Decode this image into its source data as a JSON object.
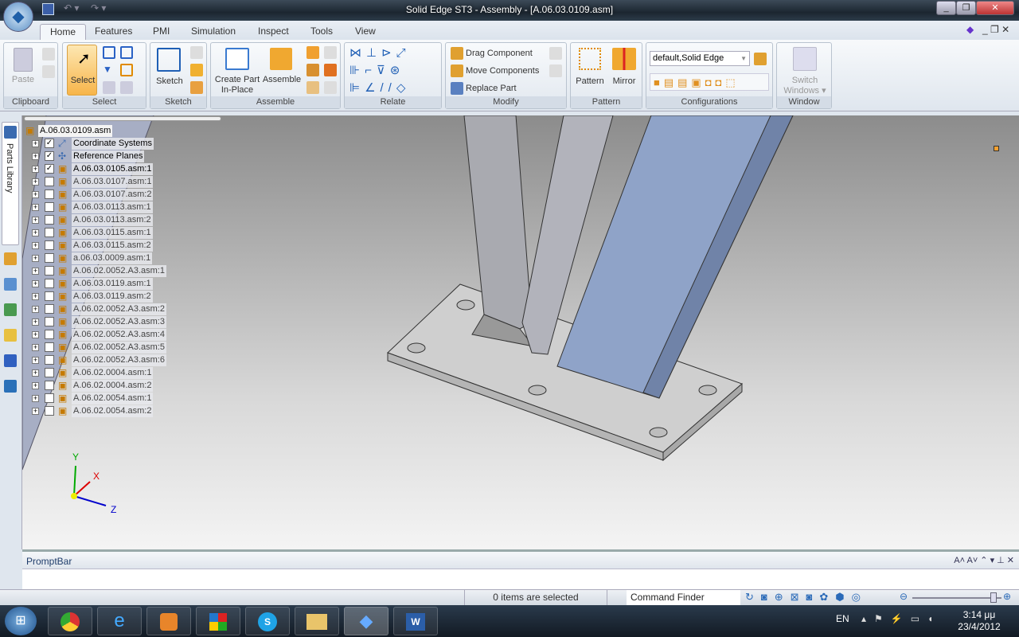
{
  "window": {
    "title": "Solid Edge ST3 - Assembly - [A.06.03.0109.asm]"
  },
  "tabs": [
    "Home",
    "Features",
    "PMI",
    "Simulation",
    "Inspect",
    "Tools",
    "View"
  ],
  "ribbon": {
    "clipboard": {
      "label": "Clipboard",
      "paste": "Paste"
    },
    "select": {
      "label": "Select",
      "select": "Select"
    },
    "sketch": {
      "label": "Sketch",
      "sketch": "Sketch"
    },
    "assemble": {
      "label": "Assemble",
      "create_part_1": "Create Part",
      "create_part_2": "In-Place",
      "assemble": "Assemble"
    },
    "relate": {
      "label": "Relate"
    },
    "modify": {
      "label": "Modify",
      "drag": "Drag Component",
      "move": "Move Components",
      "replace": "Replace Part"
    },
    "pattern": {
      "label": "Pattern",
      "pattern": "Pattern",
      "mirror": "Mirror"
    },
    "configurations": {
      "label": "Configurations",
      "value": "default,Solid Edge"
    },
    "window": {
      "label": "Window",
      "switch_1": "Switch",
      "switch_2": "Windows"
    }
  },
  "sidebar": {
    "parts_library": "Parts Library"
  },
  "tree": {
    "root": "A.06.03.0109.asm",
    "items": [
      {
        "label": "Coordinate Systems",
        "checked": true
      },
      {
        "label": "Reference Planes",
        "checked": true
      },
      {
        "label": "A.06.03.0105.asm:1",
        "checked": true
      },
      {
        "label": "A.06.03.0107.asm:1",
        "checked": false
      },
      {
        "label": "A.06.03.0107.asm:2",
        "checked": false
      },
      {
        "label": "A.06.03.0113.asm:1",
        "checked": false
      },
      {
        "label": "A.06.03.0113.asm:2",
        "checked": false
      },
      {
        "label": "A.06.03.0115.asm:1",
        "checked": false
      },
      {
        "label": "A.06.03.0115.asm:2",
        "checked": false
      },
      {
        "label": "a.06.03.0009.asm:1",
        "checked": false
      },
      {
        "label": "A.06.02.0052.A3.asm:1",
        "checked": false
      },
      {
        "label": "A.06.03.0119.asm:1",
        "checked": false
      },
      {
        "label": "A.06.03.0119.asm:2",
        "checked": false
      },
      {
        "label": "A.06.02.0052.A3.asm:2",
        "checked": false
      },
      {
        "label": "A.06.02.0052.A3.asm:3",
        "checked": false
      },
      {
        "label": "A.06.02.0052.A3.asm:4",
        "checked": false
      },
      {
        "label": "A.06.02.0052.A3.asm:5",
        "checked": false
      },
      {
        "label": "A.06.02.0052.A3.asm:6",
        "checked": false
      },
      {
        "label": "A.06.02.0004.asm:1",
        "checked": false
      },
      {
        "label": "A.06.02.0004.asm:2",
        "checked": false
      },
      {
        "label": "A.06.02.0054.asm:1",
        "checked": false
      },
      {
        "label": "A.06.02.0054.asm:2",
        "checked": false
      }
    ]
  },
  "triad": {
    "x": "X",
    "y": "Y",
    "z": "Z"
  },
  "promptbar": {
    "title": "PromptBar"
  },
  "status": {
    "selection": "0 items are selected",
    "command_finder": "Command Finder"
  },
  "taskbar": {
    "lang": "EN",
    "time": "3:14 μμ",
    "date": "23/4/2012"
  },
  "colors": {
    "accent": "#f5b041",
    "beam_blue": "#8fa3c8",
    "plate": "#cfcfcf"
  }
}
